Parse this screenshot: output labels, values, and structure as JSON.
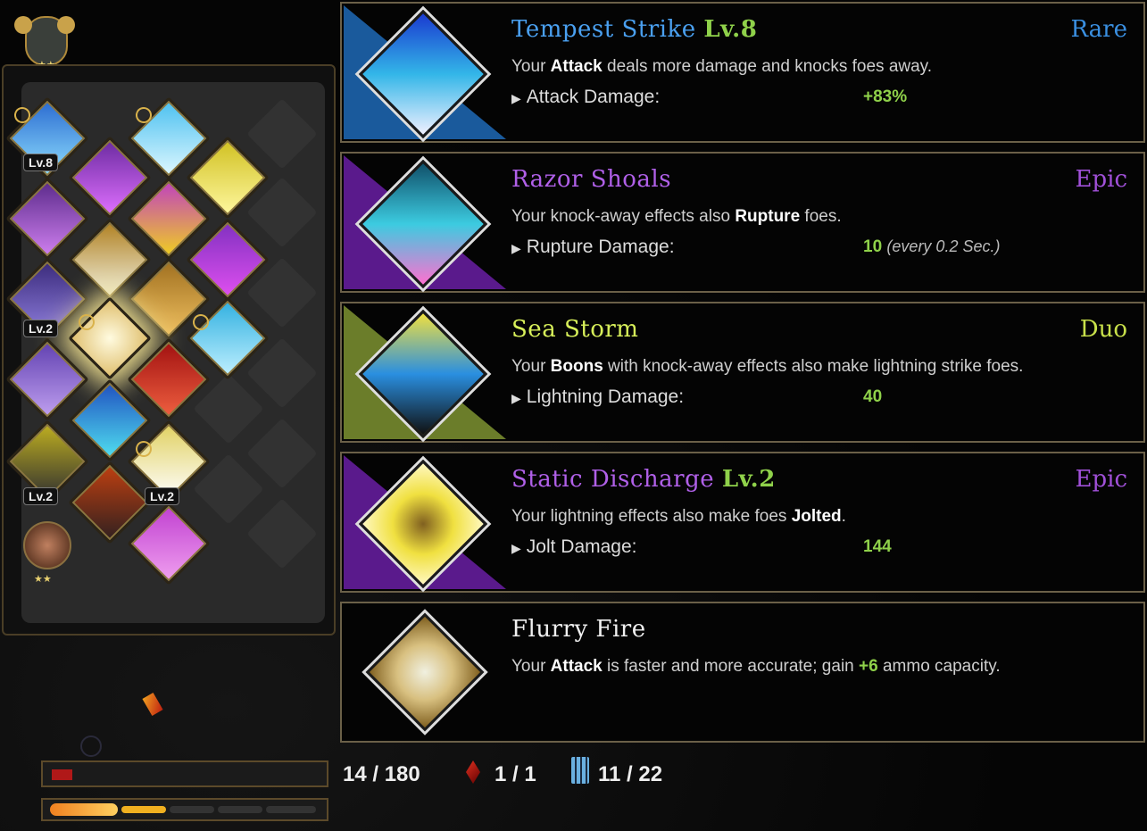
{
  "board": {
    "rank_count": "2",
    "levels": [
      "Lv.8",
      "Lv.2",
      "Lv.2",
      "Lv.2"
    ]
  },
  "cards": [
    {
      "name": "Tempest Strike",
      "level": "Lv.8",
      "rarity": "Rare",
      "rarity_color": "#3a8fe0",
      "desc_pre": "Your ",
      "desc_bold": "Attack",
      "desc_post": " deals more damage and knocks foes away.",
      "stat_label": "Attack Damage:",
      "stat_value": "+83%",
      "stat_note": "",
      "color": "#1a5a9c",
      "icon_color": "#33b6e8"
    },
    {
      "name": "Razor Shoals",
      "level": "",
      "rarity": "Epic",
      "rarity_color": "#a050d8",
      "desc_pre": "Your knock-away effects also ",
      "desc_bold": "Rupture",
      "desc_post": " foes.",
      "stat_label": "Rupture Damage:",
      "stat_value": "10",
      "stat_note": "(every 0.2 Sec.)",
      "color": "#5a1a8c",
      "icon_color": "#3ccbe0"
    },
    {
      "name": "Sea Storm",
      "level": "",
      "rarity": "Duo",
      "rarity_color": "#c8e04a",
      "desc_pre": "Your ",
      "desc_bold": "Boons",
      "desc_post": " with knock-away effects also make lightning strike foes.",
      "stat_label": "Lightning Damage:",
      "stat_value": "40",
      "stat_note": "",
      "color": "#6b7d2a",
      "icon_color": "#2a8fe0"
    },
    {
      "name": "Static Discharge",
      "level": "Lv.2",
      "rarity": "Epic",
      "rarity_color": "#a050d8",
      "desc_pre": "Your lightning effects also make foes ",
      "desc_bold": "Jolted",
      "desc_post": ".",
      "stat_label": "Jolt Damage:",
      "stat_value": "144",
      "stat_note": "",
      "color": "#5a1a8c",
      "icon_color": "#f0e040"
    },
    {
      "name": "Flurry Fire",
      "level": "",
      "rarity": "",
      "rarity_color": "#ffffff",
      "desc_pre": "Your ",
      "desc_bold": "Attack",
      "desc_post": " is faster and more accurate; gain ",
      "desc_green": "+6",
      "desc_tail": " ammo capacity.",
      "stat_label": "",
      "stat_value": "",
      "stat_note": "",
      "color": "#000000",
      "icon_color": "#d8c080"
    }
  ],
  "hud": {
    "health": "14 / 180",
    "health_fraction": 0.078,
    "death_defiance": "1 / 1",
    "ammo": "11 / 22"
  }
}
